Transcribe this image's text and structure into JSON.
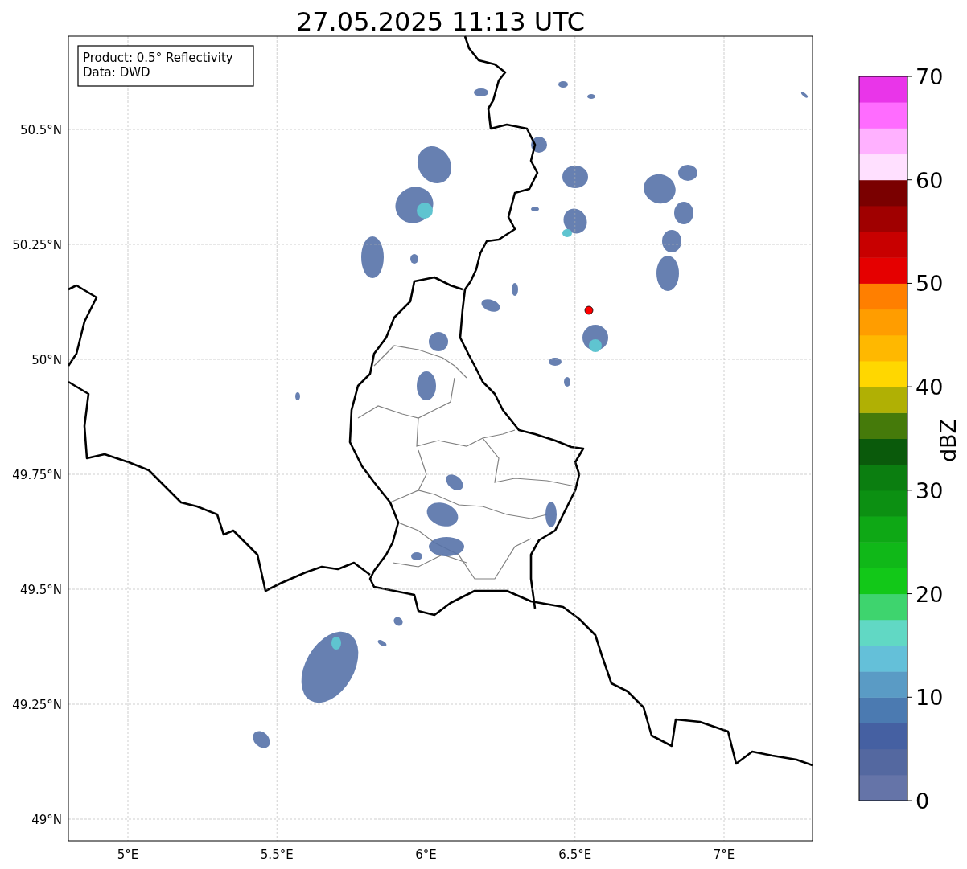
{
  "title": "27.05.2025 11:13 UTC",
  "info_box": [
    "Product: 0.5° Reflectivity",
    "Data: DWD"
  ],
  "map": {
    "lat_ticks": [
      "50.5°N",
      "50.25°N",
      "50°N",
      "49.75°N",
      "49.5°N",
      "49.25°N",
      "49°N"
    ],
    "lon_ticks": [
      "5°E",
      "5.5°E",
      "6°E",
      "6.5°E",
      "7°E"
    ]
  },
  "colorbar": {
    "label": "dBZ",
    "ticks": [
      "70",
      "60",
      "50",
      "40",
      "30",
      "20",
      "10",
      "0"
    ],
    "segments": [
      {
        "color": "#6574a8"
      },
      {
        "color": "#5468a0"
      },
      {
        "color": "#4560a2"
      },
      {
        "color": "#4b7ab1"
      },
      {
        "color": "#5a9bc5"
      },
      {
        "color": "#64c0d9"
      },
      {
        "color": "#61d8c4"
      },
      {
        "color": "#3ed46e"
      },
      {
        "color": "#12c818"
      },
      {
        "color": "#10b818"
      },
      {
        "color": "#0ea815"
      },
      {
        "color": "#0c9012"
      },
      {
        "color": "#0b7e10"
      },
      {
        "color": "#0a5a0b"
      },
      {
        "color": "#457a0a"
      },
      {
        "color": "#b0b004"
      },
      {
        "color": "#ffd700"
      },
      {
        "color": "#ffb800"
      },
      {
        "color": "#ff9d00"
      },
      {
        "color": "#ff7f00"
      },
      {
        "color": "#e50000"
      },
      {
        "color": "#c80000"
      },
      {
        "color": "#a00000"
      },
      {
        "color": "#7a0000"
      },
      {
        "color": "#ffe0ff"
      },
      {
        "color": "#ffb1ff"
      },
      {
        "color": "#ff6cff"
      },
      {
        "color": "#e935e9"
      }
    ]
  }
}
